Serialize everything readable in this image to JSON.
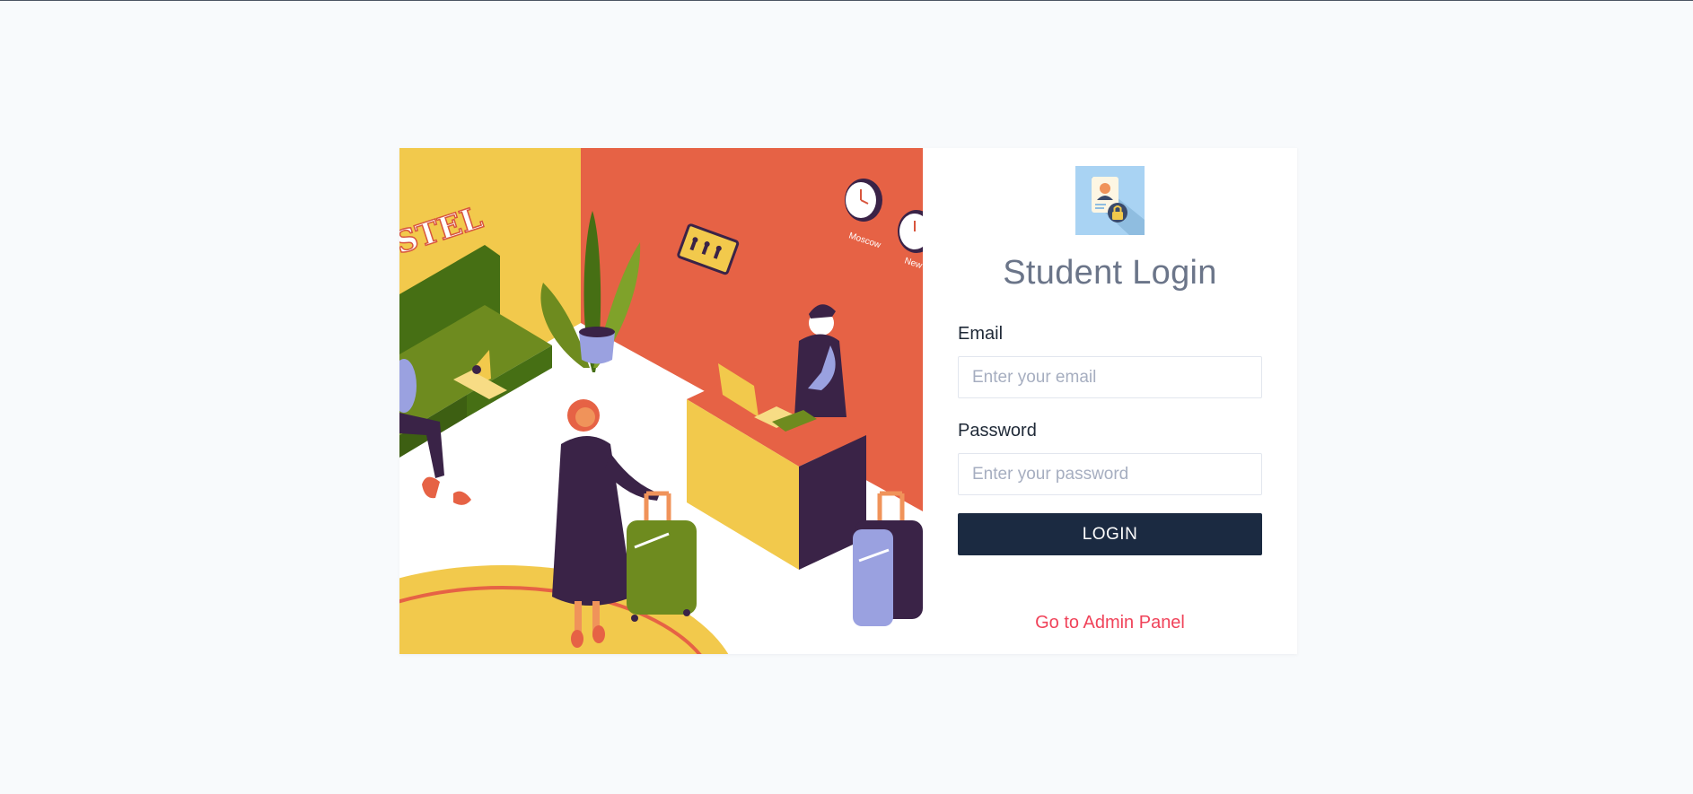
{
  "login": {
    "title": "Student Login",
    "email_label": "Email",
    "email_placeholder": "Enter your email",
    "email_value": "",
    "password_label": "Password",
    "password_placeholder": "Enter your password",
    "password_value": "",
    "login_button": "LOGIN",
    "admin_link": "Go to Admin Panel"
  },
  "illustration": {
    "sign_text": "STEL",
    "clock_left_label": "Moscow",
    "clock_right_label": "New Y"
  },
  "colors": {
    "page_bg": "#f8fafc",
    "title": "#6b7589",
    "button_bg": "#1b2a41",
    "link": "#f0435a",
    "wall_yellow": "#f2c94c",
    "wall_red": "#e66245",
    "sofa_green": "#6e8b1f"
  },
  "icons": {
    "logo": "student-id-lock-icon",
    "illustration": "hotel-reception-illustration"
  }
}
